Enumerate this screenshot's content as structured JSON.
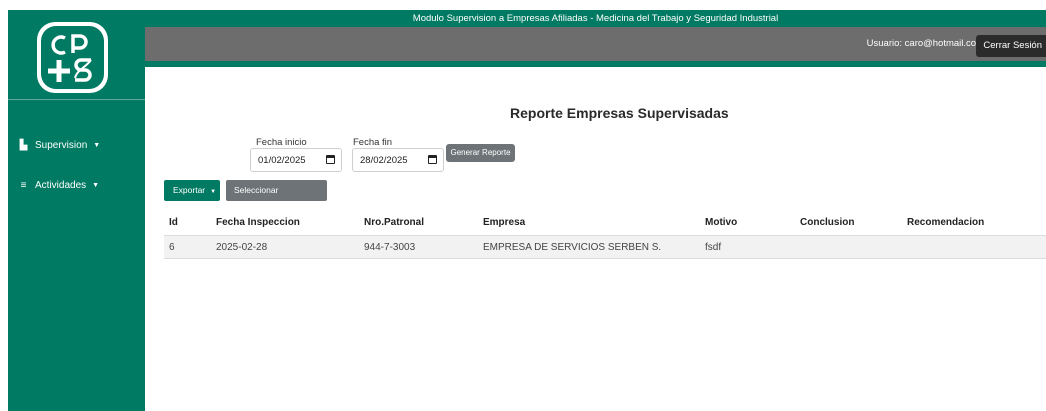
{
  "header": {
    "title": "Modulo Supervision a Empresas Afiliadas - Medicina del Trabajo y Seguridad Industrial",
    "user_label": "Usuario: caro@hotmail.com",
    "logout_label": "Cerrar Sesión"
  },
  "sidebar": {
    "logo_text": "cps",
    "items": [
      {
        "label": "Supervision",
        "icon": "building-icon"
      },
      {
        "label": "Actividades",
        "icon": "menu-lines-icon"
      }
    ]
  },
  "report": {
    "title": "Reporte Empresas Supervisadas",
    "start_label": "Fecha inicio",
    "start_value": "01/02/2025",
    "end_label": "Fecha fin",
    "end_value": "28/02/2025",
    "generate_label": "Generar Reporte",
    "export_label": "Exportar",
    "columns_label": "Seleccionar columnas"
  },
  "table": {
    "headers": [
      "Id",
      "Fecha Inspeccion",
      "Nro.Patronal",
      "Empresa",
      "Motivo",
      "Conclusion",
      "Recomendacion"
    ],
    "rows": [
      [
        "6",
        "2025-02-28",
        "944-7-3003",
        "EMPRESA DE SERVICIOS SERBEN S.",
        "fsdf",
        "",
        ""
      ]
    ]
  },
  "colors": {
    "primary": "#007a62",
    "grey_bar": "#6d6d6d",
    "button_grey": "#6d7377",
    "logout_bg": "#2b2b2b"
  }
}
